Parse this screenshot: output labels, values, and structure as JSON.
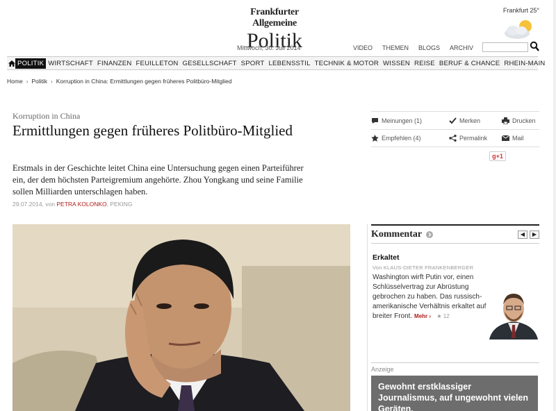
{
  "masthead": {
    "paper_name": "Frankfurter Allgemeine",
    "section": "Politik",
    "date": "Mittwoch, 30. Juli 2014",
    "weather": "Frankfurt 25°",
    "weather_icon": "partly-cloudy-icon",
    "top_links": [
      "VIDEO",
      "THEMEN",
      "BLOGS",
      "ARCHIV"
    ],
    "search_placeholder": ""
  },
  "nav": {
    "active": "POLITIK",
    "items": [
      "POLITIK",
      "WIRTSCHAFT",
      "FINANZEN",
      "FEUILLETON",
      "GESELLSCHAFT",
      "SPORT",
      "LEBENSSTIL",
      "TECHNIK & MOTOR",
      "WISSEN",
      "REISE",
      "BERUF & CHANCE",
      "RHEIN-MAIN"
    ]
  },
  "breadcrumb": [
    "Home",
    "Politik",
    "Korruption in China: Ermittlungen gegen früheres Politbüro-Mitglied"
  ],
  "article": {
    "kicker": "Korruption in China",
    "headline": "Ermittlungen gegen früheres Politbüro-Mitglied",
    "lede": "Erstmals in der Geschichte leitet China eine Untersuchung gegen einen Parteiführer ein, der dem höchsten Parteigremium angehörte. Zhou Yongkang und seine Familie sollen Milliarden unterschlagen haben.",
    "byline_date": "29.07.2014, von",
    "author": "PETRA KOLONKO",
    "location": ", PEKING"
  },
  "tools": {
    "meinungen": "Meinungen (1)",
    "merken": "Merken",
    "drucken": "Drucken",
    "empfehlen": "Empfehlen (4)",
    "permalink": "Permalink",
    "mail": "Mail",
    "gplus": "g+1"
  },
  "kommentar": {
    "title": "Kommentar",
    "article_title": "Erkaltet",
    "author": "Von KLAUS-DIETER FRANKENBERGER",
    "text": "Washington wirft Putin vor, einen Schlüsselvertrag zur Abrüstung gebrochen zu haben. Das russisch-amerikanische Verhältnis erkaltet auf breiter Front.",
    "mehr": "Mehr",
    "rating": "12"
  },
  "ad": {
    "label": "Anzeige",
    "text": "Gewohnt erstklassiger Journalismus, auf ungewohnt vielen Geräten."
  },
  "colors": {
    "accent": "#b21b1b",
    "nav_active": "#111111",
    "ad_bg": "#6d6d6d"
  }
}
